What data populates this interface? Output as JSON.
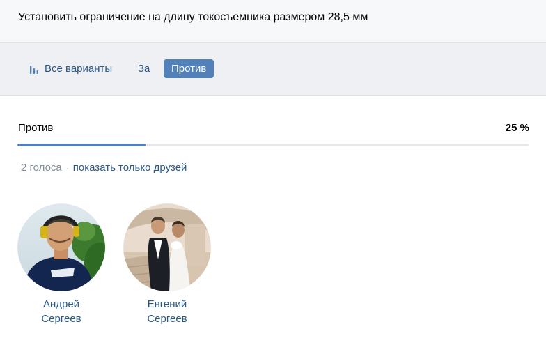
{
  "poll": {
    "title": "Установить ограничение на длину токосъемника размером 28,5 мм"
  },
  "tabs": {
    "all_label": "Все варианты",
    "for_label": "За",
    "against_label": "Против"
  },
  "result": {
    "option_label": "Против",
    "percent_label": "25 %",
    "percent_value": 25
  },
  "votes": {
    "count_label": "2 голоса",
    "separator": "·",
    "friends_link": "показать только друзей"
  },
  "voters": [
    {
      "first_name": "Андрей",
      "last_name": "Сергеев"
    },
    {
      "first_name": "Евгений",
      "last_name": "Сергеев"
    }
  ],
  "colors": {
    "accent": "#5181b8",
    "link": "#2a5885",
    "muted": "#818c99"
  },
  "icons": {
    "all_tab_icon": "bar-chart-icon"
  }
}
